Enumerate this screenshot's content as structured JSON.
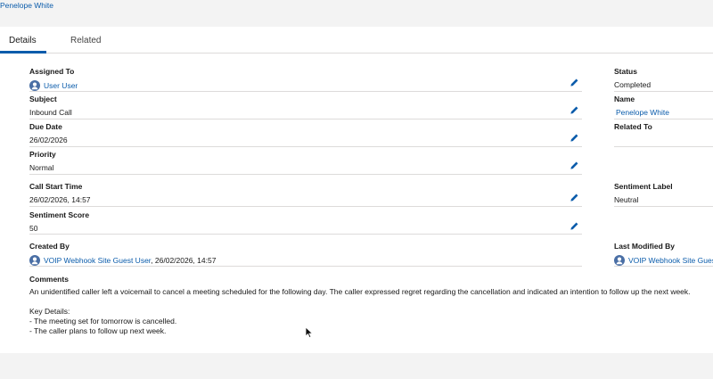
{
  "header": {
    "record_name": "Penelope White"
  },
  "tabs": [
    {
      "label": "Details",
      "active": true
    },
    {
      "label": "Related",
      "active": false
    }
  ],
  "fields": {
    "assigned_to": {
      "label": "Assigned To",
      "value": "User User"
    },
    "subject": {
      "label": "Subject",
      "value": "Inbound Call"
    },
    "due_date": {
      "label": "Due Date",
      "value": "26/02/2026"
    },
    "priority": {
      "label": "Priority",
      "value": "Normal"
    },
    "call_start_time": {
      "label": "Call Start Time",
      "value": "26/02/2026, 14:57"
    },
    "sentiment_score": {
      "label": "Sentiment Score",
      "value": "50"
    },
    "created_by": {
      "label": "Created By",
      "value": "VOIP Webhook Site Guest User",
      "suffix": ", 26/02/2026, 14:57"
    },
    "status": {
      "label": "Status",
      "value": "Completed"
    },
    "name": {
      "label": "Name",
      "value": "Penelope White"
    },
    "related_to": {
      "label": "Related To",
      "value": ""
    },
    "sentiment_label": {
      "label": "Sentiment Label",
      "value": "Neutral"
    },
    "last_modified_by": {
      "label": "Last Modified By",
      "value": "VOIP Webhook Site Guest"
    }
  },
  "comments": {
    "label": "Comments",
    "lines": [
      "An unidentified caller left a voicemail to cancel a meeting scheduled for the following day. The caller expressed regret regarding the cancellation and indicated an intention to follow up the next week.",
      "",
      "Key Details:",
      "- The meeting set for tomorrow is cancelled.",
      "- The caller plans to follow up next week."
    ]
  },
  "icons": {
    "edit": "pencil-icon",
    "user": "user-avatar-icon"
  },
  "colors": {
    "link": "#0b5cab",
    "active_tab": "#0b5cab",
    "background": "#f3f3f3"
  }
}
